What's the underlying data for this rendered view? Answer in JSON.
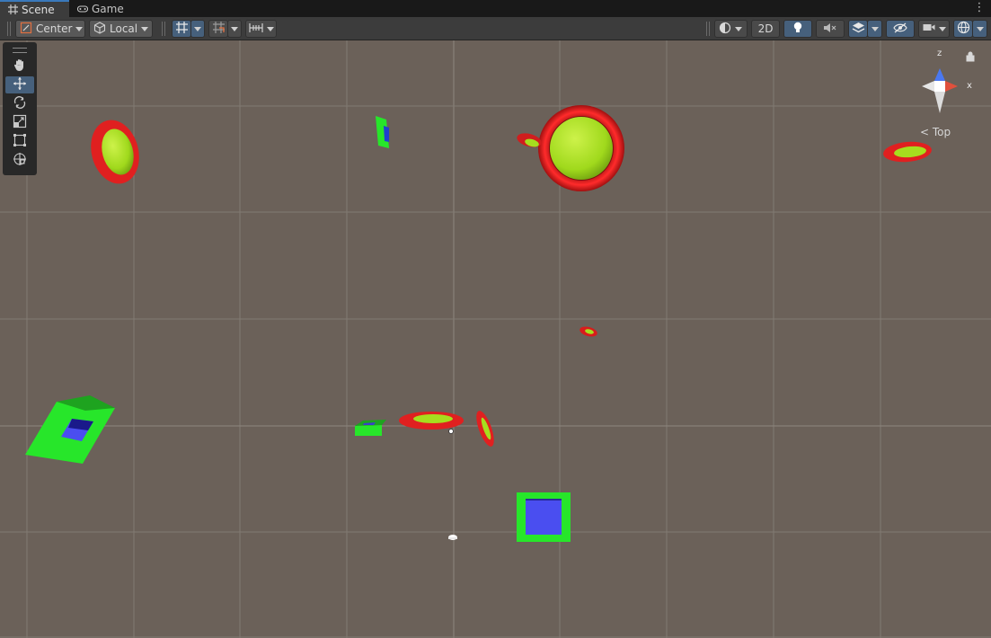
{
  "tabs": [
    {
      "label": "Scene",
      "icon": "grid-icon",
      "active": true
    },
    {
      "label": "Game",
      "icon": "gamepad-icon",
      "active": false
    }
  ],
  "toolbar": {
    "pivot_mode": "Center",
    "pivot_rotation": "Local",
    "two_d_label": "2D"
  },
  "tools": [
    {
      "name": "hand-tool",
      "icon": "hand-icon",
      "active": false
    },
    {
      "name": "move-tool",
      "icon": "move-icon",
      "active": true
    },
    {
      "name": "rotate-tool",
      "icon": "rotate-icon",
      "active": false
    },
    {
      "name": "scale-tool",
      "icon": "scale-icon",
      "active": false
    },
    {
      "name": "rect-tool",
      "icon": "rect-transform-icon",
      "active": false
    },
    {
      "name": "transform-tool",
      "icon": "transform-icon",
      "active": false
    }
  ],
  "gizmo": {
    "view_label": "Top",
    "axis_z": "z",
    "axis_x": "x"
  },
  "colors": {
    "scene_bg": "#6b6159",
    "grid": "#827a72",
    "ring_red": "#e02020",
    "sphere_yellow_green": "#a8e61e",
    "box_green": "#27e62a",
    "box_blue": "#4a4ef0",
    "active_blue": "#46607c"
  }
}
